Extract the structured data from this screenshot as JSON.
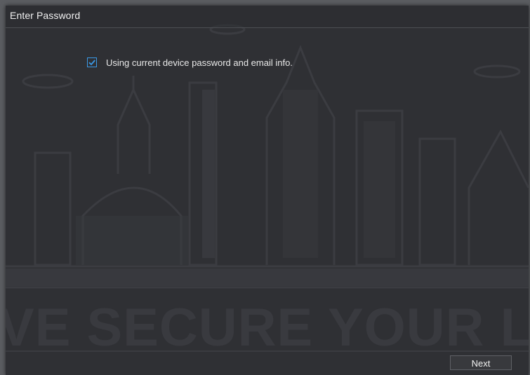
{
  "dialog": {
    "title": "Enter Password"
  },
  "option": {
    "checked": true,
    "label": "Using current device password and email info."
  },
  "footer": {
    "next_label": "Next"
  },
  "background": {
    "slogan": "VE SECURE YOUR L"
  },
  "colors": {
    "panel": "#2f3034",
    "accent_checkbox": "#3a9ae8",
    "text": "#e9e9e9"
  }
}
